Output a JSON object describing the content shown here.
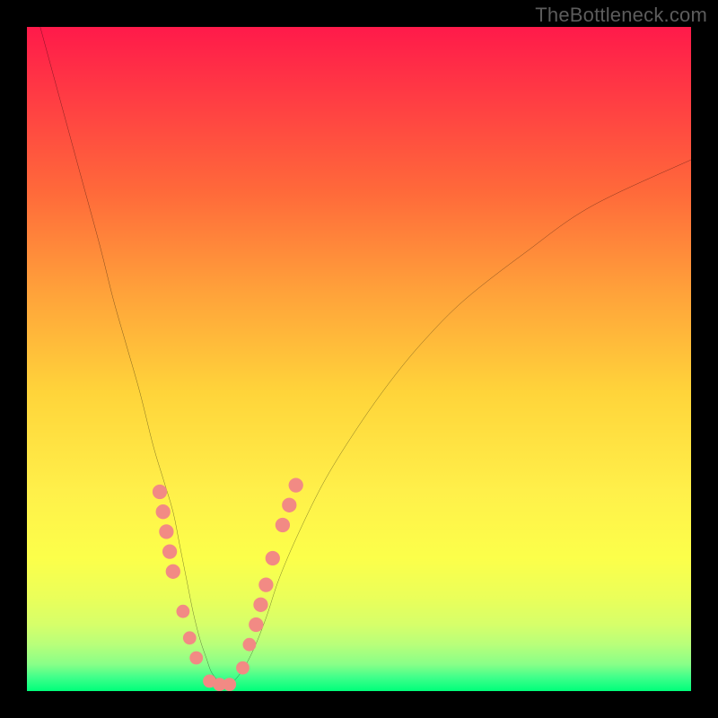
{
  "watermark": "TheBottleneck.com",
  "colors": {
    "frame": "#000000",
    "marker": "#f28a84",
    "curve": "#000000",
    "grad_top": "#ff1a4a",
    "grad_bottom": "#00ff7a"
  },
  "chart_data": {
    "type": "line",
    "title": "",
    "xlabel": "",
    "ylabel": "",
    "xlim": [
      0,
      100
    ],
    "ylim": [
      0,
      100
    ],
    "grid": false,
    "legend": false,
    "series": [
      {
        "name": "bottleneck-curve",
        "x": [
          2,
          5,
          8,
          11,
          13,
          15,
          17,
          19,
          20.5,
          22,
          23,
          24,
          25,
          26,
          27,
          28,
          30,
          32,
          34,
          36,
          38,
          41,
          45,
          50,
          55,
          60,
          66,
          75,
          85,
          100
        ],
        "values": [
          100,
          89,
          78,
          67,
          59,
          52,
          45,
          37,
          32,
          27,
          22,
          17,
          12,
          8,
          5,
          2.5,
          0.8,
          2.5,
          6,
          11,
          17,
          24,
          32,
          40,
          47,
          53,
          59,
          66,
          73,
          80
        ]
      }
    ],
    "markers": [
      {
        "x": 20.0,
        "y": 30,
        "r": 1.1
      },
      {
        "x": 20.5,
        "y": 27,
        "r": 1.1
      },
      {
        "x": 21.0,
        "y": 24,
        "r": 1.1
      },
      {
        "x": 21.5,
        "y": 21,
        "r": 1.1
      },
      {
        "x": 22.0,
        "y": 18,
        "r": 1.1
      },
      {
        "x": 23.5,
        "y": 12,
        "r": 1.0
      },
      {
        "x": 24.5,
        "y": 8,
        "r": 1.0
      },
      {
        "x": 25.5,
        "y": 5,
        "r": 1.0
      },
      {
        "x": 27.5,
        "y": 1.5,
        "r": 1.0
      },
      {
        "x": 29.0,
        "y": 1.0,
        "r": 1.0
      },
      {
        "x": 30.5,
        "y": 1.0,
        "r": 1.0
      },
      {
        "x": 32.5,
        "y": 3.5,
        "r": 1.0
      },
      {
        "x": 33.5,
        "y": 7,
        "r": 1.0
      },
      {
        "x": 34.5,
        "y": 10,
        "r": 1.1
      },
      {
        "x": 35.2,
        "y": 13,
        "r": 1.1
      },
      {
        "x": 36.0,
        "y": 16,
        "r": 1.1
      },
      {
        "x": 37.0,
        "y": 20,
        "r": 1.1
      },
      {
        "x": 38.5,
        "y": 25,
        "r": 1.1
      },
      {
        "x": 39.5,
        "y": 28,
        "r": 1.1
      },
      {
        "x": 40.5,
        "y": 31,
        "r": 1.1
      }
    ]
  }
}
